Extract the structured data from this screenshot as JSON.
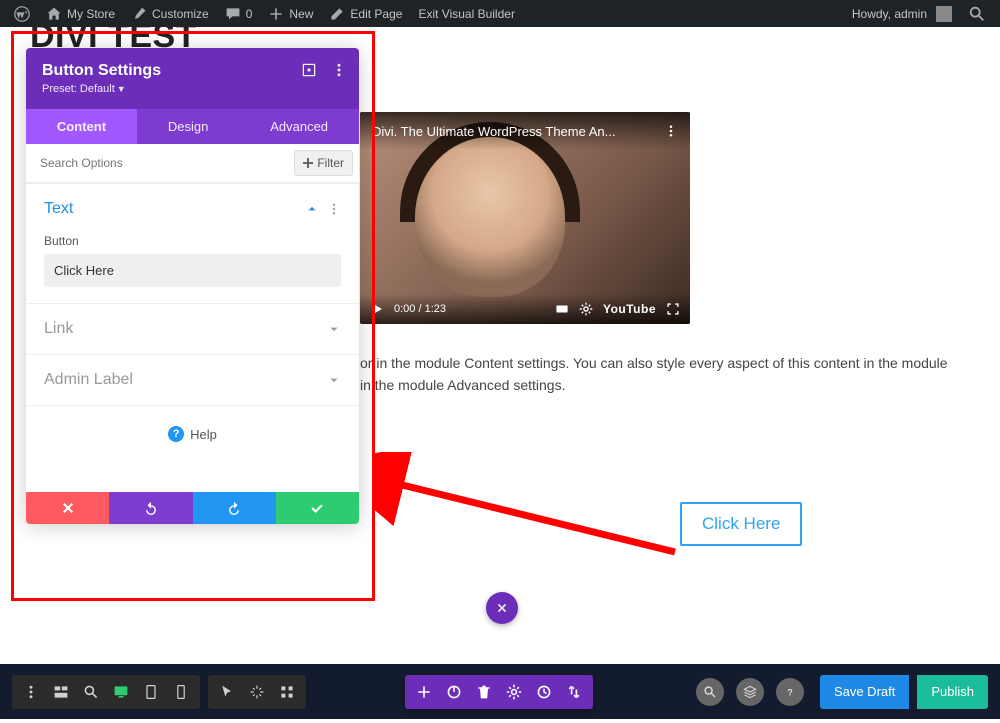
{
  "admin_bar": {
    "site_name": "My Store",
    "customize": "Customize",
    "comments": "0",
    "new": "New",
    "edit_page": "Edit Page",
    "exit_builder": "Exit Visual Builder",
    "greeting": "Howdy, admin"
  },
  "page": {
    "title": "DIVI TEST"
  },
  "video": {
    "title": "Divi. The Ultimate WordPress Theme An...",
    "time": "0:00 / 1:23",
    "provider": "YouTube"
  },
  "body_text": {
    "line1": "or in the module Content settings. You can also style every aspect of this content in the module",
    "line2": "in the module Advanced settings."
  },
  "button_preview": {
    "label": "Click Here"
  },
  "modal": {
    "title": "Button Settings",
    "preset": "Preset: Default",
    "tabs": {
      "content": "Content",
      "design": "Design",
      "advanced": "Advanced"
    },
    "search_placeholder": "Search Options",
    "filter_label": "Filter",
    "sections": {
      "text": {
        "title": "Text",
        "field_label": "Button",
        "field_value": "Click Here"
      },
      "link": {
        "title": "Link"
      },
      "admin_label": {
        "title": "Admin Label"
      }
    },
    "help": "Help"
  },
  "builder_bar": {
    "save_draft": "Save Draft",
    "publish": "Publish"
  }
}
